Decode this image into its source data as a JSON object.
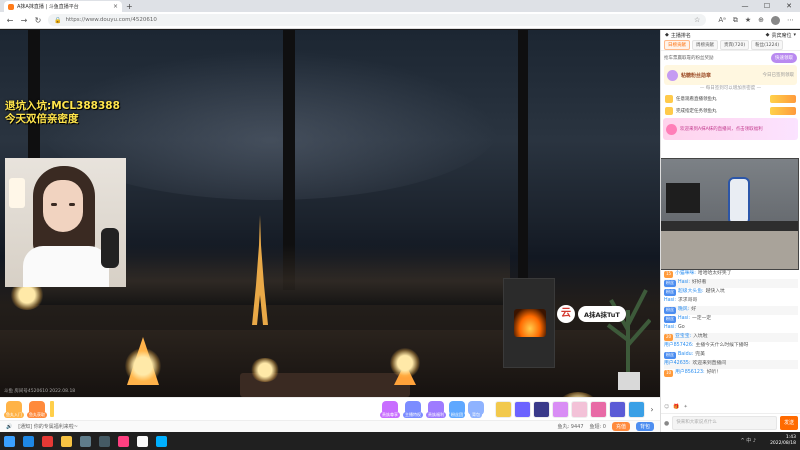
{
  "browser": {
    "tab_title": "A抹A抹直播 | 斗鱼直播平台",
    "new_tab": "+",
    "url": "https://www.douyu.com/4520610",
    "win_min": "—",
    "win_max": "☐",
    "win_close": "✕"
  },
  "video": {
    "cam_text_line1": "退坑入坑:MCL388388",
    "cam_text_line2": "今天双倍亲密度",
    "ne_logo": "云",
    "ne_name": "A抹A抹TuT",
    "watermark": "斗鱼 房间号4520610  2022.08.18"
  },
  "giftbar": {
    "left_items": [
      {
        "label": "鱼丸入门",
        "color": "#ffb347"
      },
      {
        "label": "鱼丸获取",
        "color": "#ff8a3c"
      }
    ],
    "center_items": [
      {
        "label": "贵族尊享",
        "color": "#c86dff"
      },
      {
        "label": "主播特权",
        "color": "#7b8cff"
      },
      {
        "label": "贵族福利",
        "color": "#9e7bff"
      },
      {
        "label": "粉丝团",
        "color": "#5fa8ff"
      },
      {
        "label": "背包",
        "color": "#8fb3ff"
      }
    ],
    "gift_colors": [
      "#f2c94c",
      "#6c63ff",
      "#3a3a8a",
      "#d98df5",
      "#f3c2d8",
      "#e86aa6",
      "#5b5bd6",
      "#3aa0e6"
    ]
  },
  "infobar": {
    "left": "[通知] 你的专属福利来啦~",
    "fish_label": "鱼丸: 9447",
    "yuchi_label": "鱼翅: 0",
    "charge": "充值",
    "backpack": "背包"
  },
  "rightpanel": {
    "top_left": "主播排名",
    "top_right": "贵宾席位",
    "tabs": [
      {
        "label": "日榜贡献",
        "active": true
      },
      {
        "label": "周榜贡献",
        "active": false
      },
      {
        "label": "贵宾(720)",
        "active": false
      },
      {
        "label": "粉丝(1224)",
        "active": false
      }
    ],
    "notice": "抢车票赢取靠的粉丝奖励",
    "notice_btn": "快速领取",
    "fans_name": "粘糖粉丝勋章",
    "fans_status": "今日已签到领取",
    "hint": "— 每日签到可以增加亲密度 —",
    "tasks": [
      {
        "text": "任意观看直播领鱼丸"
      },
      {
        "text": "完成指定任务领鱼丸"
      }
    ],
    "banner_text": "欢迎来到A抹A抹的直播间，点击领取福利",
    "chat": [
      {
        "lv": "15",
        "badge": "",
        "nick": "小猫咪咪:",
        "text": "哈哈哈太好笑了"
      },
      {
        "lv": "",
        "badge": "粉丝",
        "nick": "Hasi:",
        "text": "好好看"
      },
      {
        "lv": "",
        "badge": "粉丝",
        "nick": "超级大头鱼:",
        "text": "越快入坑"
      },
      {
        "lv": "",
        "badge": "",
        "nick": "Hasi:",
        "text": "求求哥哥"
      },
      {
        "lv": "",
        "badge": "粉丝",
        "nick": "晚风:",
        "text": "好"
      },
      {
        "lv": "",
        "badge": "粉丝",
        "nick": "Hasi:",
        "text": "一定一定"
      },
      {
        "lv": "",
        "badge": "",
        "nick": "Hasi:",
        "text": "Go"
      },
      {
        "lv": "20",
        "badge": "",
        "nick": "亚宝宝:",
        "text": "入坑啦"
      },
      {
        "lv": "",
        "badge": "",
        "nick": "用户857426:",
        "text": "主播今天什么时候下播呀"
      },
      {
        "lv": "",
        "badge": "粉丝",
        "nick": "Baidu:",
        "text": "完美"
      },
      {
        "lv": "",
        "badge": "",
        "nick": "用户42635:",
        "text": "欢迎来到直播间"
      },
      {
        "lv": "10",
        "badge": "",
        "nick": "用户856123:",
        "text": "好听！"
      }
    ],
    "chat_placeholder": "快来和大家说点什么",
    "send_label": "发送"
  },
  "taskbar": {
    "time": "1:43",
    "date": "2022/08/18",
    "tray": "^ 中 ♪",
    "app_colors": [
      "#1e88e5",
      "#e53935",
      "#f6c343",
      "#607d8b",
      "#455a64",
      "#ff4081",
      "#fafafa",
      "#00b0ff"
    ]
  }
}
